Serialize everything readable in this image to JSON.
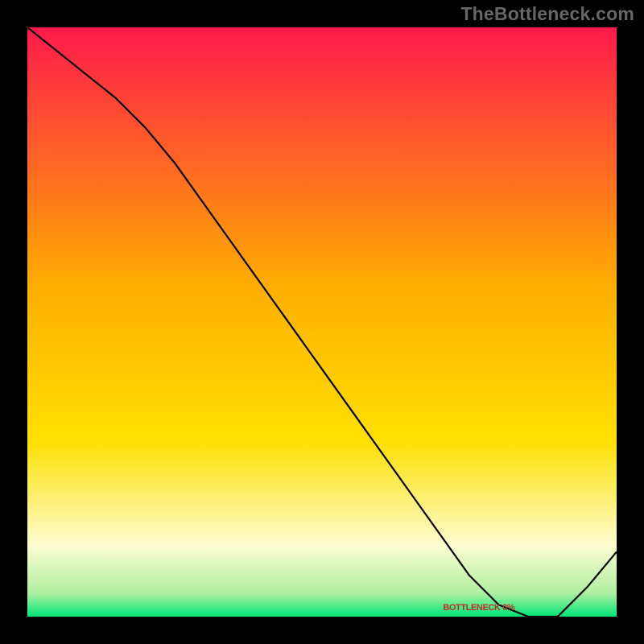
{
  "watermark": "TheBottleneck.com",
  "annotation": "BOTTLENECK 0%",
  "chart_data": {
    "type": "line",
    "title": "",
    "xlabel": "",
    "ylabel": "",
    "xlim": [
      0,
      1
    ],
    "ylim": [
      0,
      1
    ],
    "x": [
      0.0,
      0.05,
      0.1,
      0.15,
      0.2,
      0.25,
      0.3,
      0.35,
      0.4,
      0.45,
      0.5,
      0.55,
      0.6,
      0.65,
      0.7,
      0.75,
      0.8,
      0.85,
      0.9,
      0.95,
      1.0
    ],
    "y": [
      1.0,
      0.96,
      0.92,
      0.88,
      0.83,
      0.77,
      0.7,
      0.63,
      0.56,
      0.49,
      0.42,
      0.35,
      0.28,
      0.21,
      0.14,
      0.07,
      0.02,
      0.0,
      0.0,
      0.05,
      0.11
    ],
    "gradient_top_color": "#ff1a4a",
    "gradient_mid_color": "#ffd400",
    "gradient_low_color": "#fcfccf",
    "gradient_bottom_color": "#00e676",
    "annotation_x": 0.76,
    "annotation_y": 0.015
  }
}
